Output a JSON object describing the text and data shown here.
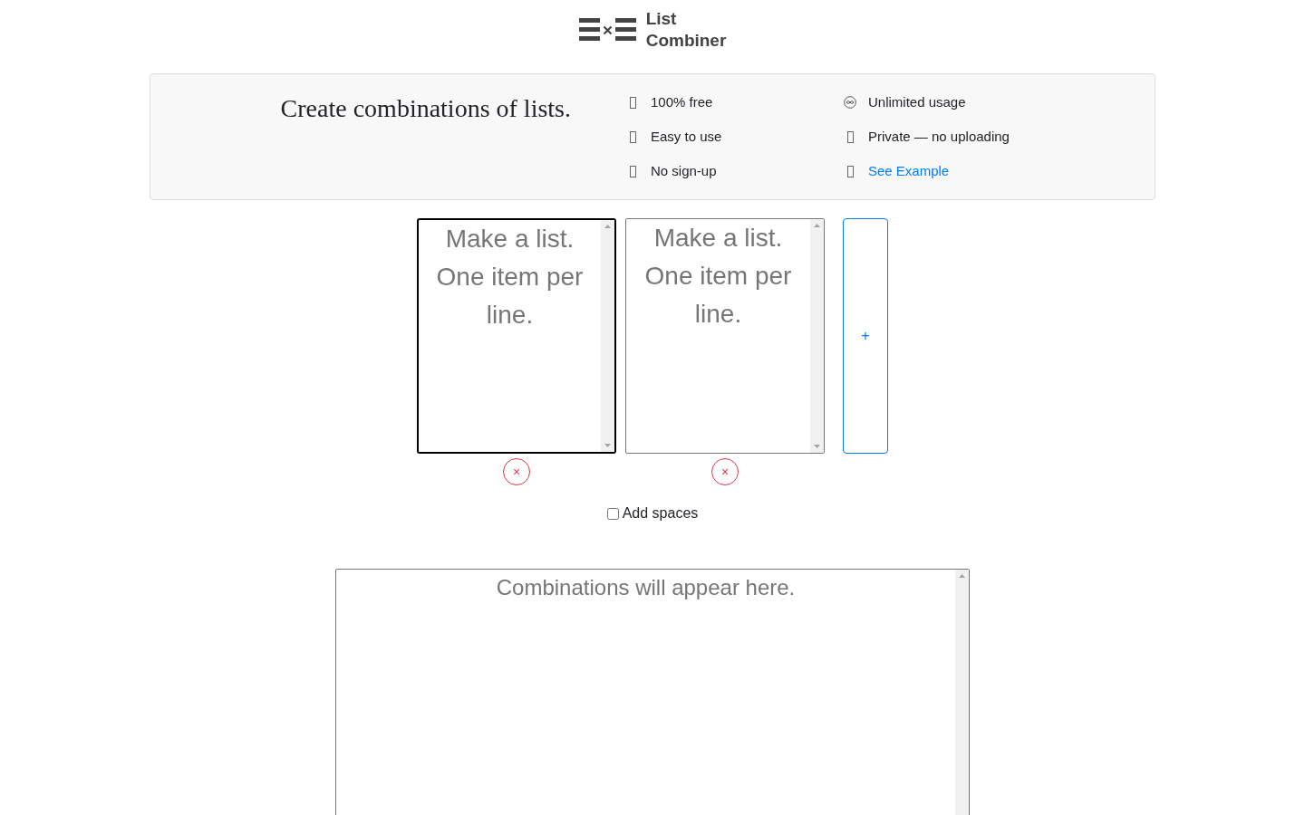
{
  "logo": {
    "title": "List Combiner"
  },
  "intro": {
    "heading": "Create combinations of lists.",
    "features": [
      {
        "kind": "text",
        "label": "100% free"
      },
      {
        "kind": "text",
        "label": "Unlimited usage"
      },
      {
        "kind": "text",
        "label": "Easy to use"
      },
      {
        "kind": "text",
        "label": "Private — no uploading"
      },
      {
        "kind": "text",
        "label": "No sign-up"
      },
      {
        "kind": "link",
        "label": "See Example"
      }
    ]
  },
  "lists": [
    {
      "placeholder": "Make a list. One item per line.",
      "focused": true,
      "remove_button": "×"
    },
    {
      "placeholder": "Make a list. One item per line.",
      "focused": false,
      "remove_button": "×"
    }
  ],
  "add_list_button": "+",
  "add_spaces": {
    "label": "Add spaces",
    "checked": false
  },
  "output": {
    "placeholder": "Combinations will appear here."
  }
}
